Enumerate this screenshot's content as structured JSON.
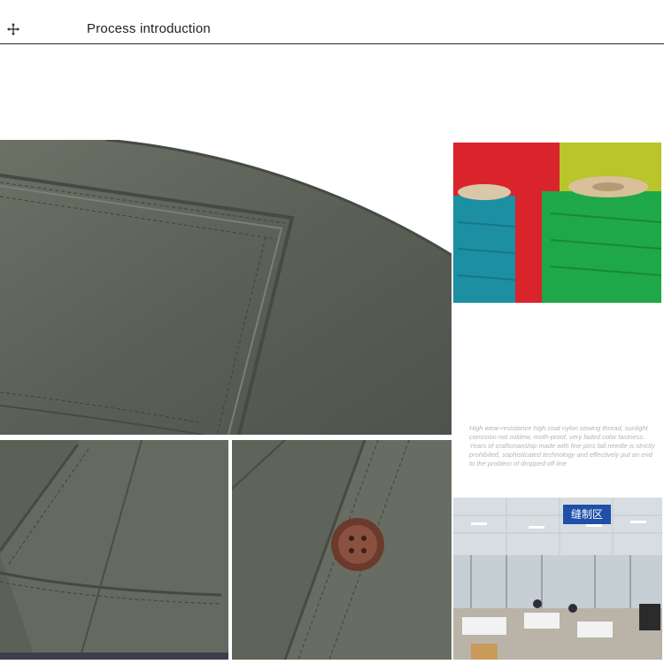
{
  "header": {
    "title": "Process introduction",
    "icon": "move-icon"
  },
  "description": "High wear-resistance high coat nylon sewing thread, sunlight corrosion not mildew, moth-proof, very faded color fastness. Years of craftsmanship made with fine pins fall needle is strictly prohibited, sophisticated technology and effectively put an end to the problem of dropped off line",
  "workshop_sign": "缝制区",
  "colors": {
    "fabric": "#5f645b",
    "thread_red": "#d8242a",
    "thread_teal": "#1d8fa3",
    "thread_green": "#1fa847",
    "sign_blue": "#1f4fa8"
  }
}
